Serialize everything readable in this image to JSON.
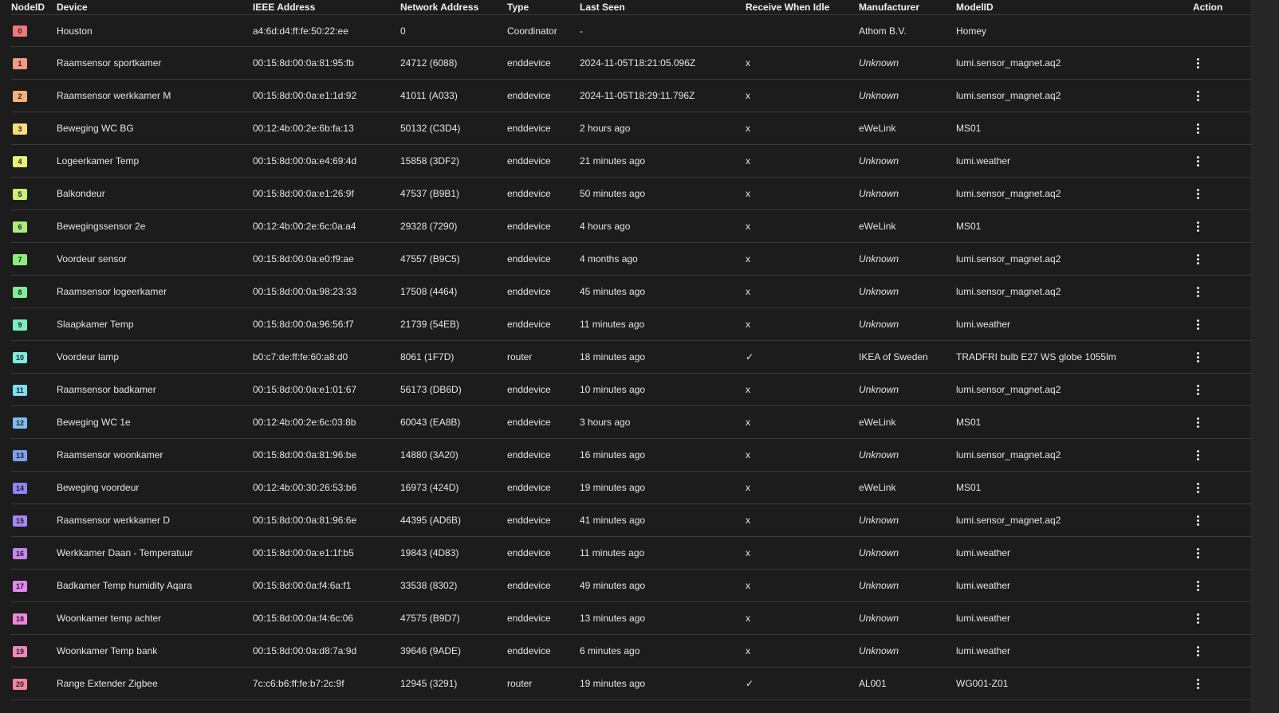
{
  "columns": {
    "node_id": "NodeID",
    "device": "Device",
    "ieee": "IEEE Address",
    "network": "Network Address",
    "type": "Type",
    "last_seen": "Last Seen",
    "receive_idle": "Receive When Idle",
    "manufacturer": "Manufacturer",
    "model": "ModelID",
    "action": "Action"
  },
  "icons": {
    "row_action": "more-vert-icon"
  },
  "rows": [
    {
      "id": "0",
      "color": "#f07878",
      "device": "Houston",
      "ieee": "a4:6d:d4:ff:fe:50:22:ee",
      "network": "0",
      "type": "Coordinator",
      "last_seen": "-",
      "idle": "",
      "manufacturer": "Athom B.V.",
      "unknown": false,
      "model": "Homey",
      "action": false
    },
    {
      "id": "1",
      "color": "#f39a80",
      "device": "Raamsensor sportkamer",
      "ieee": "00:15:8d:00:0a:81:95:fb",
      "network": "24712 (6088)",
      "type": "enddevice",
      "last_seen": "2024-11-05T18:21:05.096Z",
      "idle": "x",
      "manufacturer": "Unknown",
      "unknown": true,
      "model": "lumi.sensor_magnet.aq2",
      "action": true
    },
    {
      "id": "2",
      "color": "#f5b07a",
      "device": "Raamsensor werkkamer M",
      "ieee": "00:15:8d:00:0a:e1:1d:92",
      "network": "41011 (A033)",
      "type": "enddevice",
      "last_seen": "2024-11-05T18:29:11.796Z",
      "idle": "x",
      "manufacturer": "Unknown",
      "unknown": true,
      "model": "lumi.sensor_magnet.aq2",
      "action": true
    },
    {
      "id": "3",
      "color": "#f5dd7a",
      "device": "Beweging WC BG",
      "ieee": "00:12:4b:00:2e:6b:fa:13",
      "network": "50132 (C3D4)",
      "type": "enddevice",
      "last_seen": "2 hours ago",
      "idle": "x",
      "manufacturer": "eWeLink",
      "unknown": false,
      "model": "MS01",
      "action": true
    },
    {
      "id": "4",
      "color": "#eaf07a",
      "device": "Logeerkamer Temp",
      "ieee": "00:15:8d:00:0a:e4:69:4d",
      "network": "15858 (3DF2)",
      "type": "enddevice",
      "last_seen": "21 minutes ago",
      "idle": "x",
      "manufacturer": "Unknown",
      "unknown": true,
      "model": "lumi.weather",
      "action": true
    },
    {
      "id": "5",
      "color": "#c8ef7a",
      "device": "Balkondeur",
      "ieee": "00:15:8d:00:0a:e1:26:9f",
      "network": "47537 (B9B1)",
      "type": "enddevice",
      "last_seen": "50 minutes ago",
      "idle": "x",
      "manufacturer": "Unknown",
      "unknown": true,
      "model": "lumi.sensor_magnet.aq2",
      "action": true
    },
    {
      "id": "6",
      "color": "#aaed7a",
      "device": "Bewegingssensor 2e",
      "ieee": "00:12:4b:00:2e:6c:0a:a4",
      "network": "29328 (7290)",
      "type": "enddevice",
      "last_seen": "4 hours ago",
      "idle": "x",
      "manufacturer": "eWeLink",
      "unknown": false,
      "model": "MS01",
      "action": true
    },
    {
      "id": "7",
      "color": "#8ced7e",
      "device": "Voordeur sensor",
      "ieee": "00:15:8d:00:0a:e0:f9:ae",
      "network": "47557 (B9C5)",
      "type": "enddevice",
      "last_seen": "4 months ago",
      "idle": "x",
      "manufacturer": "Unknown",
      "unknown": true,
      "model": "lumi.sensor_magnet.aq2",
      "action": true
    },
    {
      "id": "8",
      "color": "#7eed9a",
      "device": "Raamsensor logeerkamer",
      "ieee": "00:15:8d:00:0a:98:23:33",
      "network": "17508 (4464)",
      "type": "enddevice",
      "last_seen": "45 minutes ago",
      "idle": "x",
      "manufacturer": "Unknown",
      "unknown": true,
      "model": "lumi.sensor_magnet.aq2",
      "action": true
    },
    {
      "id": "9",
      "color": "#7eedbd",
      "device": "Slaapkamer Temp",
      "ieee": "00:15:8d:00:0a:96:56:f7",
      "network": "21739 (54EB)",
      "type": "enddevice",
      "last_seen": "11 minutes ago",
      "idle": "x",
      "manufacturer": "Unknown",
      "unknown": true,
      "model": "lumi.weather",
      "action": true
    },
    {
      "id": "10",
      "color": "#7eedde",
      "device": "Voordeur lamp",
      "ieee": "b0:c7:de:ff:fe:60:a8:d0",
      "network": "8061 (1F7D)",
      "type": "router",
      "last_seen": "18 minutes ago",
      "idle": "✓",
      "manufacturer": "IKEA of Sweden",
      "unknown": false,
      "model": "TRADFRI bulb E27 WS globe 1055lm",
      "action": true
    },
    {
      "id": "11",
      "color": "#7edcf0",
      "device": "Raamsensor badkamer",
      "ieee": "00:15:8d:00:0a:e1:01:67",
      "network": "56173 (DB6D)",
      "type": "enddevice",
      "last_seen": "10 minutes ago",
      "idle": "x",
      "manufacturer": "Unknown",
      "unknown": true,
      "model": "lumi.sensor_magnet.aq2",
      "action": true
    },
    {
      "id": "12",
      "color": "#7ebdf2",
      "device": "Beweging WC 1e",
      "ieee": "00:12:4b:00:2e:6c:03:8b",
      "network": "60043 (EA8B)",
      "type": "enddevice",
      "last_seen": "3 hours ago",
      "idle": "x",
      "manufacturer": "eWeLink",
      "unknown": false,
      "model": "MS01",
      "action": true
    },
    {
      "id": "13",
      "color": "#7e9ef2",
      "device": "Raamsensor woonkamer",
      "ieee": "00:15:8d:00:0a:81:96:be",
      "network": "14880 (3A20)",
      "type": "enddevice",
      "last_seen": "16 minutes ago",
      "idle": "x",
      "manufacturer": "Unknown",
      "unknown": true,
      "model": "lumi.sensor_magnet.aq2",
      "action": true
    },
    {
      "id": "14",
      "color": "#8a86f2",
      "device": "Beweging voordeur",
      "ieee": "00:12:4b:00:30:26:53:b6",
      "network": "16973 (424D)",
      "type": "enddevice",
      "last_seen": "19 minutes ago",
      "idle": "x",
      "manufacturer": "eWeLink",
      "unknown": false,
      "model": "MS01",
      "action": true
    },
    {
      "id": "15",
      "color": "#a886f2",
      "device": "Raamsensor werkkamer D",
      "ieee": "00:15:8d:00:0a:81:96:6e",
      "network": "44395 (AD6B)",
      "type": "enddevice",
      "last_seen": "41 minutes ago",
      "idle": "x",
      "manufacturer": "Unknown",
      "unknown": true,
      "model": "lumi.sensor_magnet.aq2",
      "action": true
    },
    {
      "id": "16",
      "color": "#c586f2",
      "device": "Werkkamer Daan - Temperatuur",
      "ieee": "00:15:8d:00:0a:e1:1f:b5",
      "network": "19843 (4D83)",
      "type": "enddevice",
      "last_seen": "11 minutes ago",
      "idle": "x",
      "manufacturer": "Unknown",
      "unknown": true,
      "model": "lumi.weather",
      "action": true
    },
    {
      "id": "17",
      "color": "#e286f0",
      "device": "Badkamer Temp humidity Aqara",
      "ieee": "00:15:8d:00:0a:f4:6a:f1",
      "network": "33538 (8302)",
      "type": "enddevice",
      "last_seen": "49 minutes ago",
      "idle": "x",
      "manufacturer": "Unknown",
      "unknown": true,
      "model": "lumi.weather",
      "action": true
    },
    {
      "id": "18",
      "color": "#f086de",
      "device": "Woonkamer temp achter",
      "ieee": "00:15:8d:00:0a:f4:6c:06",
      "network": "47575 (B9D7)",
      "type": "enddevice",
      "last_seen": "13 minutes ago",
      "idle": "x",
      "manufacturer": "Unknown",
      "unknown": true,
      "model": "lumi.weather",
      "action": true
    },
    {
      "id": "19",
      "color": "#f086bd",
      "device": "Woonkamer Temp bank",
      "ieee": "00:15:8d:00:0a:d8:7a:9d",
      "network": "39646 (9ADE)",
      "type": "enddevice",
      "last_seen": "6 minutes ago",
      "idle": "x",
      "manufacturer": "Unknown",
      "unknown": true,
      "model": "lumi.weather",
      "action": true
    },
    {
      "id": "20",
      "color": "#f0869a",
      "device": "Range Extender Zigbee",
      "ieee": "7c:c6:b6:ff:fe:b7:2c:9f",
      "network": "12945 (3291)",
      "type": "router",
      "last_seen": "19 minutes ago",
      "idle": "✓",
      "manufacturer": "AL001",
      "unknown": false,
      "model": "WG001-Z01",
      "action": true
    }
  ]
}
